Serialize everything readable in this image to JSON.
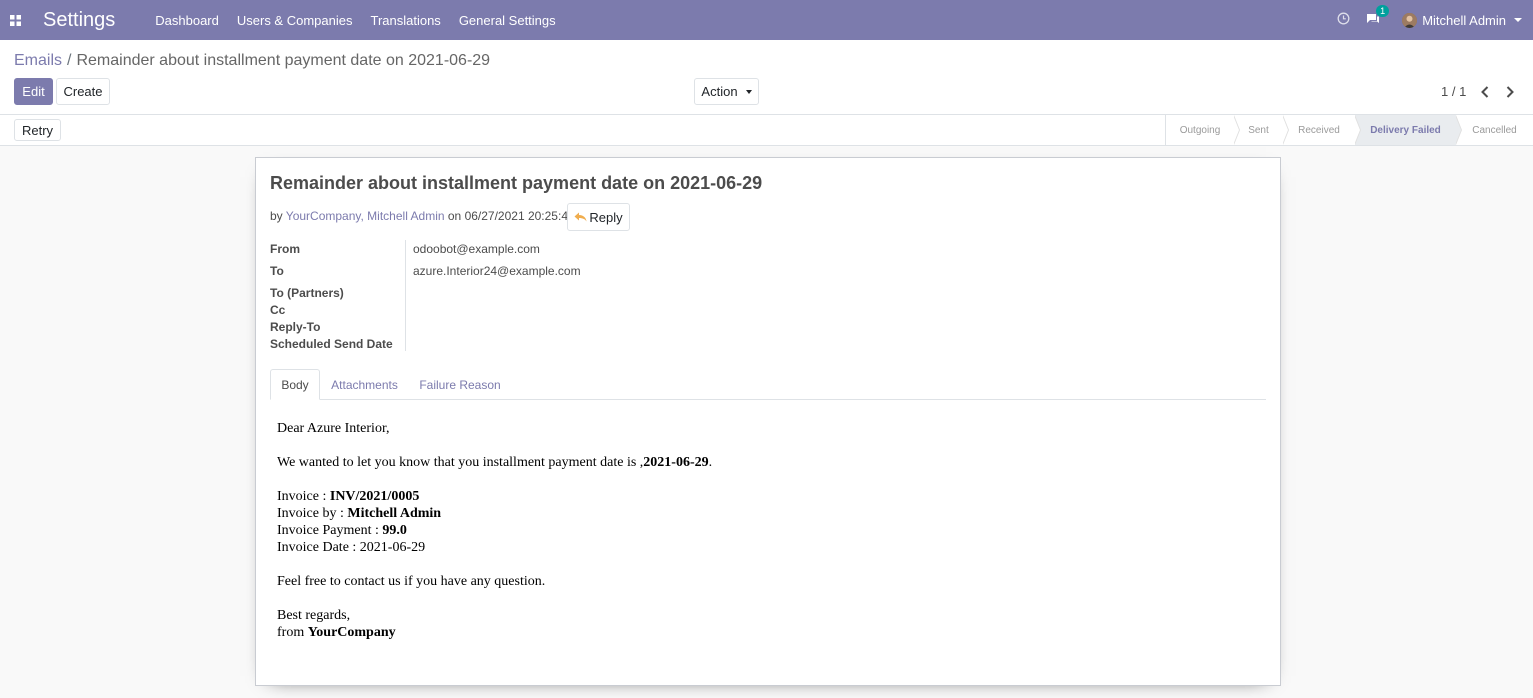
{
  "topbar": {
    "app_title": "Settings",
    "menu": [
      "Dashboard",
      "Users & Companies",
      "Translations",
      "General Settings"
    ],
    "chat_badge": "1",
    "user_name": "Mitchell Admin"
  },
  "breadcrumb": {
    "parent": "Emails",
    "separator": "/",
    "current": "Remainder about installment payment date on 2021-06-29"
  },
  "buttons": {
    "edit": "Edit",
    "create": "Create",
    "action": "Action",
    "retry": "Retry",
    "reply": "Reply"
  },
  "pager": {
    "value": "1 / 1"
  },
  "stages": {
    "items": [
      "Outgoing",
      "Sent",
      "Received",
      "Delivery Failed",
      "Cancelled"
    ],
    "active": "Delivery Failed"
  },
  "message": {
    "subject": "Remainder about installment payment date on 2021-06-29",
    "by_prefix": "by ",
    "author": "YourCompany, Mitchell Admin",
    "on_prefix": " on ",
    "date": "06/27/2021 20:25:43"
  },
  "fields": {
    "from_label": "From",
    "from_value": "odoobot@example.com",
    "to_label": "To",
    "to_value": "azure.Interior24@example.com",
    "to_partners_label": "To (Partners)",
    "cc_label": "Cc",
    "reply_to_label": "Reply-To",
    "scheduled_label": "Scheduled Send Date"
  },
  "tabs": [
    "Body",
    "Attachments",
    "Failure Reason"
  ],
  "body": {
    "greeting": "Dear Azure Interior,",
    "intro_text": "We wanted to let you know that you installment payment date is ,",
    "intro_date": "2021-06-29",
    "intro_end": ".",
    "invoice_label": "Invoice : ",
    "invoice_value": "INV/2021/0005",
    "invoice_by_label": "Invoice by : ",
    "invoice_by_value": "Mitchell Admin",
    "payment_label": "Invoice Payment : ",
    "payment_value": "99.0",
    "date_line": "Invoice Date : 2021-06-29",
    "contact": "Feel free to contact us if you have any question.",
    "regards": "Best regards,",
    "from_label": "from ",
    "from_value": "YourCompany"
  },
  "colors": {
    "brand": "#7c7bad",
    "badge": "#00a09d"
  }
}
